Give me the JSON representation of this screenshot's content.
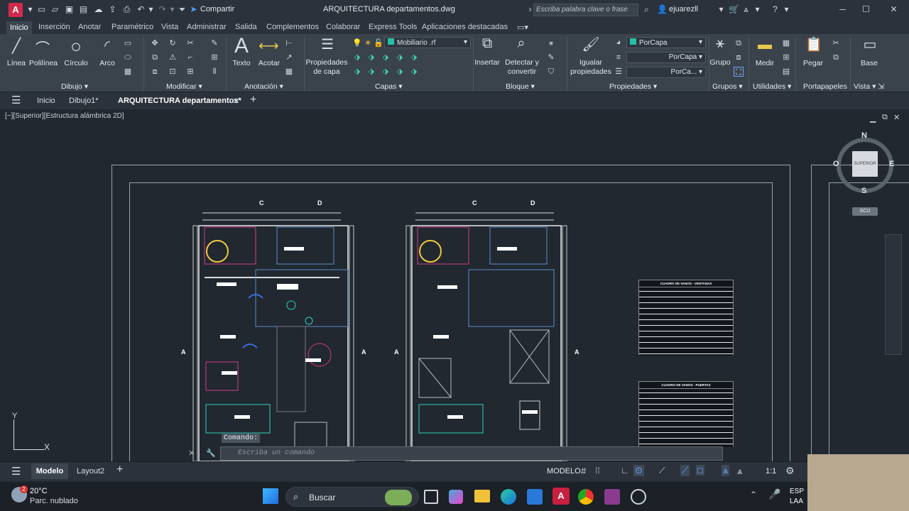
{
  "titlebar": {
    "app_letter": "A",
    "share_label": "Compartir",
    "file_title": "ARQUITECTURA departamentos.dwg",
    "search_placeholder": "Escriba palabra clave o frase",
    "user": "ejuarezll"
  },
  "ribbon_tabs": [
    "Inicio",
    "Inserción",
    "Anotar",
    "Paramétrico",
    "Vista",
    "Administrar",
    "Salida",
    "Complementos",
    "Colaborar",
    "Express Tools",
    "Aplicaciones destacadas"
  ],
  "tools": {
    "linea": "Línea",
    "polilinea": "Polilínea",
    "circulo": "Círculo",
    "arco": "Arco",
    "texto": "Texto",
    "acotar": "Acotar",
    "prop_capa": "Propiedades\nde capa",
    "insertar": "Insertar",
    "detectar": "Detectar y\nconvertir",
    "igualar": "Igualar\npropiedades",
    "grupo": "Grupo",
    "medir": "Medir",
    "pegar": "Pegar",
    "base": "Base"
  },
  "panels": {
    "dibujo": "Dibujo",
    "modificar": "Modificar",
    "anotacion": "Anotación",
    "capas": "Capas",
    "bloque": "Bloque",
    "propiedades": "Propiedades",
    "grupos": "Grupos",
    "utilidades": "Utilidades",
    "portapapeles": "Portapapeles",
    "vista": "Vista"
  },
  "layer_combo": "Mobiliario .rf",
  "prop_combos": {
    "color": "PorCapa",
    "linetype": "PorCapa",
    "lineweight": "PorCa..."
  },
  "file_tabs": {
    "inicio": "Inicio",
    "dibujo1": "Dibujo1*",
    "current": "ARQUITECTURA departamentos*"
  },
  "viewport_label": "[−][Superior][Estructura alámbrica 2D]",
  "viewcube": {
    "n": "N",
    "s": "S",
    "e": "E",
    "w": "O",
    "face": "SUPERIOR",
    "wcs": "SCU"
  },
  "axis_labels": {
    "y": "Y",
    "x": "X"
  },
  "plan_labels": {
    "c": "C",
    "d": "D",
    "a": "A"
  },
  "tables": {
    "ventanas": "CUADRO DE VANOS - VENTANAS",
    "puertas": "CUADRO DE VANOS - PUERTAS"
  },
  "command": {
    "history": "Comando:",
    "placeholder": "Escriba un comando"
  },
  "status": {
    "modelo_tab": "Modelo",
    "layout2": "Layout2",
    "space": "MODELO",
    "scale": "1:1"
  },
  "taskbar": {
    "temp": "20°C",
    "weather": "Parc. nublado",
    "search": "Buscar",
    "lang1": "ESP",
    "lang2": "LAA",
    "badge": "2"
  }
}
